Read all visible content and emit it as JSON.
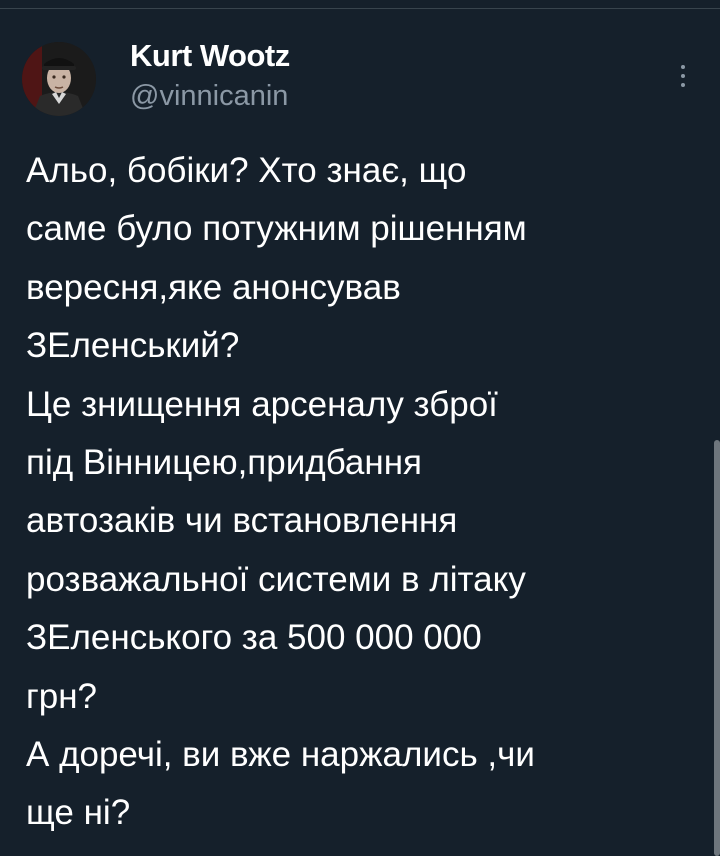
{
  "tweet": {
    "author": {
      "display_name": "Kurt Wootz",
      "handle": "@vinnicanin",
      "avatar_icon": "user-avatar-portrait"
    },
    "more_icon": "more-vertical-icon",
    "text_lines": [
      "Альо, бобіки? Хто знає, що",
      "саме було потужним рішенням",
      "вересня,яке анонсував",
      "ЗЕленський?",
      "Це знищення арсеналу зброї",
      "під Вінницею,придбання",
      "автозаків чи встановлення",
      "розважальної системи в літаку",
      "ЗЕленського за 500 000 000",
      "грн?",
      "А доречі, ви вже наржались ,чи",
      "ще ні?"
    ]
  },
  "colors": {
    "background": "#15202b",
    "primary_text": "#ffffff",
    "secondary_text": "#8b98a5",
    "divider": "#38444d"
  }
}
